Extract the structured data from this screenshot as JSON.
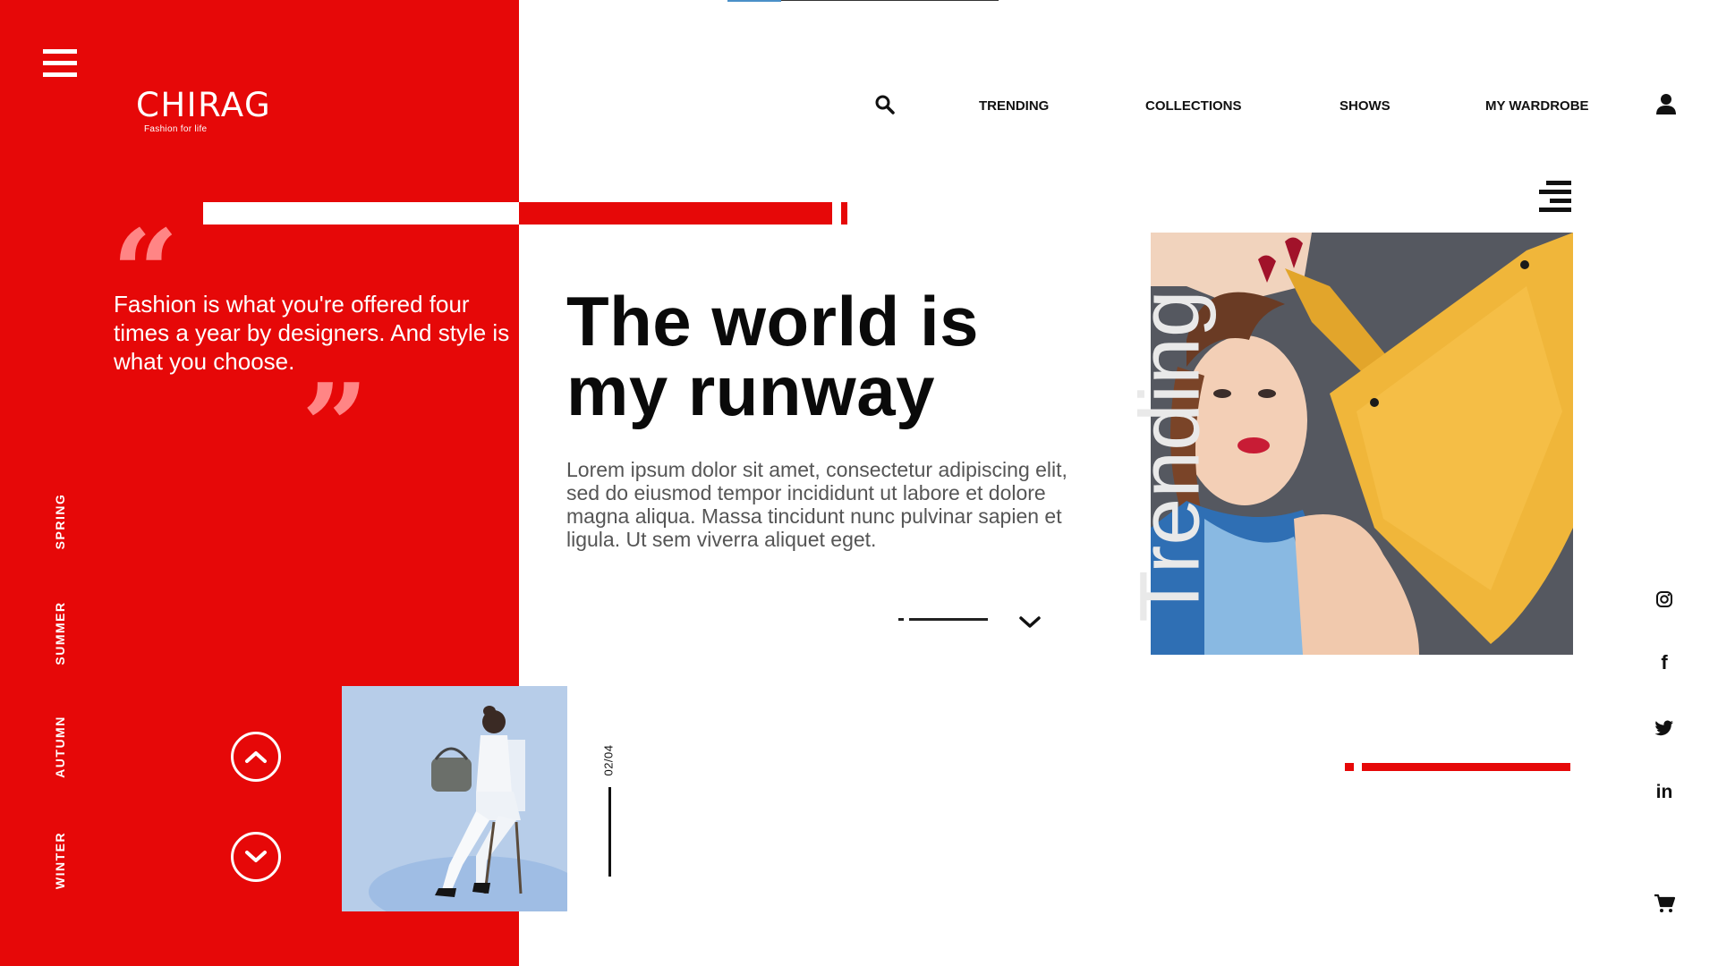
{
  "brand": {
    "name": "CHIRAG",
    "tagline": "Fashion for life"
  },
  "nav": {
    "links": [
      "TRENDING",
      "COLLECTIONS",
      "SHOWS",
      "MY WARDROBE"
    ]
  },
  "quote": {
    "open_mark": "“",
    "text": "Fashion is what you're offered four times a year by designers. And style is what you choose.",
    "close_mark": "”"
  },
  "seasons": [
    "SPRING",
    "SUMMER",
    "AUTUMN",
    "WINTER"
  ],
  "hero": {
    "headline_line1": "The world is",
    "headline_line2": "my runway",
    "body": "Lorem ipsum dolor sit amet, consectetur adipiscing elit, sed do eiusmod tempor incididunt ut labore et dolore magna aliqua. Massa tincidunt nunc pulvinar sapien et ligula. Ut sem viverra aliquet eget."
  },
  "feature": {
    "vertical_label": "Trending"
  },
  "slider": {
    "counter": "02/04"
  },
  "social": {
    "instagram": "instagram-icon",
    "facebook": "f",
    "twitter": "twitter-icon",
    "linkedin": "in"
  },
  "colors": {
    "accent": "#e60808",
    "quote_marks": "#ff8585",
    "text_dark": "#0a0a0a",
    "text_body": "#555555"
  }
}
